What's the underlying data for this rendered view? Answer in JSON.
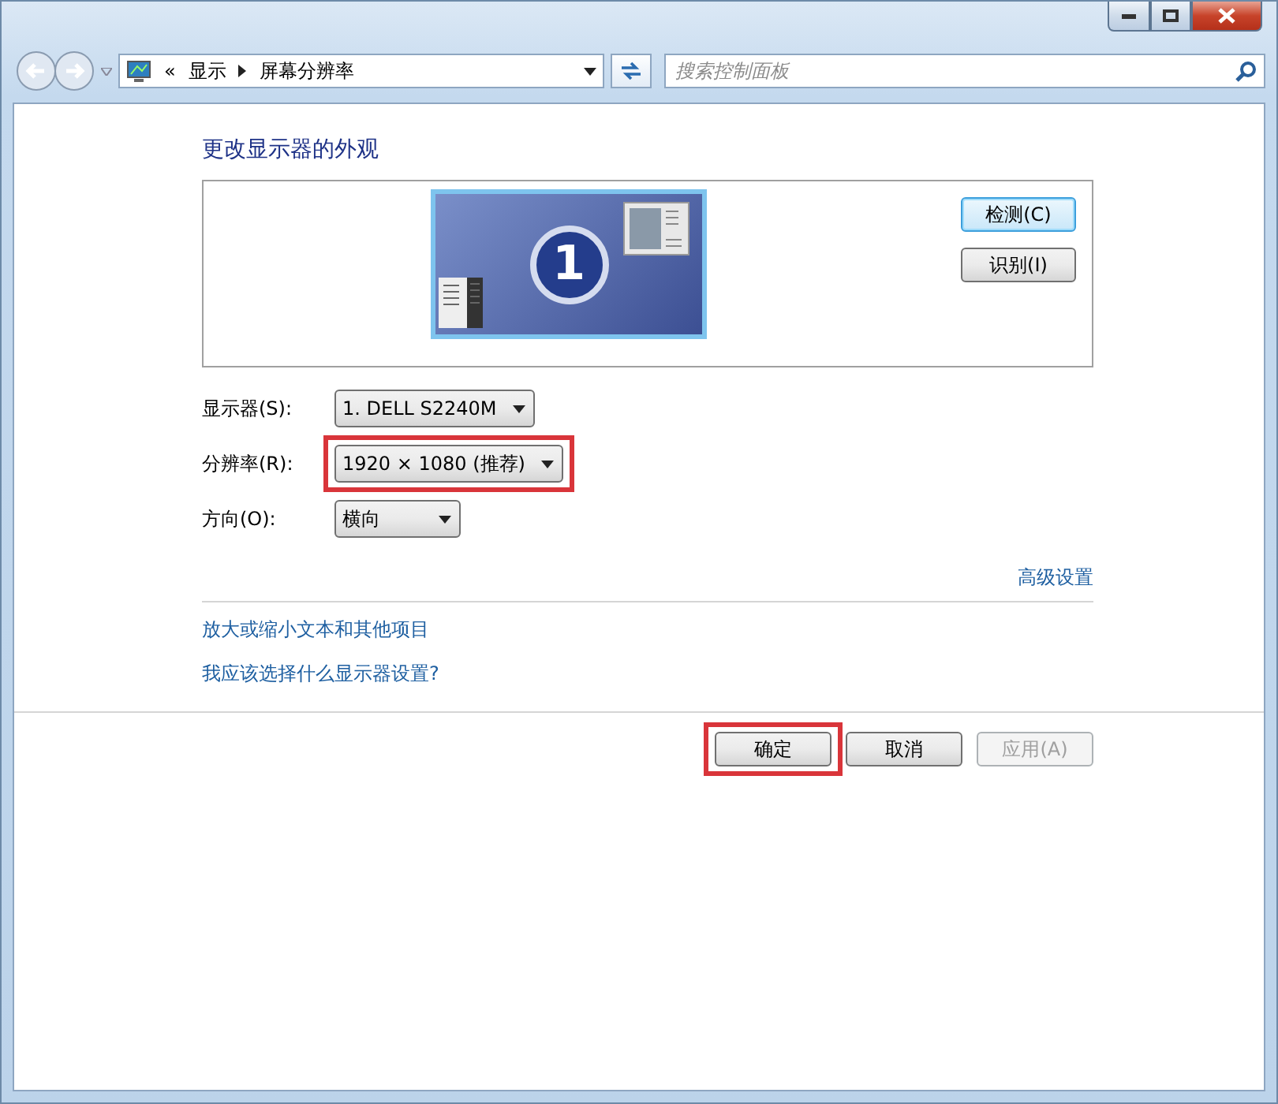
{
  "address_bar": {
    "overflow": "«",
    "crumbs": [
      "显示",
      "屏幕分辨率"
    ]
  },
  "search": {
    "placeholder": "搜索控制面板"
  },
  "heading": "更改显示器的外观",
  "preview": {
    "monitor_number": "1"
  },
  "side_buttons": [
    {
      "label": "检测(C)",
      "focused": true
    },
    {
      "label": "识别(I)",
      "focused": false
    }
  ],
  "settings": [
    {
      "label": "显示器(S):",
      "value": "1. DELL S2240M",
      "highlighted": false
    },
    {
      "label": "分辨率(R):",
      "value": "1920 × 1080 (推荐)",
      "highlighted": true
    },
    {
      "label": "方向(O):",
      "value": "横向",
      "highlighted": false
    }
  ],
  "advanced_link": "高级设置",
  "links": [
    "放大或缩小文本和其他项目",
    "我应该选择什么显示器设置?"
  ],
  "buttons": [
    {
      "label": "确定",
      "highlighted": true,
      "disabled": false
    },
    {
      "label": "取消",
      "highlighted": false,
      "disabled": false
    },
    {
      "label": "应用(A)",
      "highlighted": false,
      "disabled": true
    }
  ]
}
